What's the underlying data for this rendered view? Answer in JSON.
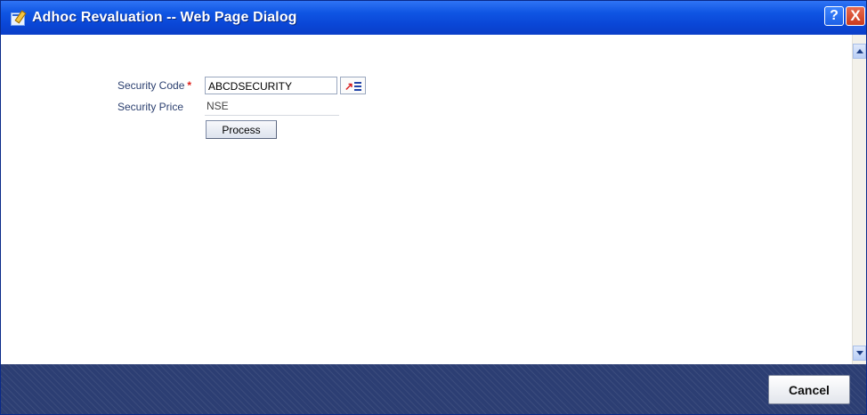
{
  "window": {
    "title": "Adhoc Revaluation -- Web Page Dialog",
    "help_button": "?",
    "close_button": "X"
  },
  "form": {
    "security_code": {
      "label": "Security Code",
      "required_marker": "*",
      "value": "ABCDSECURITY"
    },
    "security_price": {
      "label": "Security Price",
      "value": "NSE"
    },
    "process_button": "Process"
  },
  "footer": {
    "cancel_button": "Cancel"
  },
  "icons": {
    "title": "page-edit-icon",
    "lov": "list-of-values-icon",
    "scroll_up": "scroll-up-arrow-icon",
    "scroll_down": "scroll-down-arrow-icon"
  },
  "colors": {
    "title_bar": "#0b4fe0",
    "footer": "#2c3e73",
    "required": "#e0201a",
    "label": "#2b3f6f"
  }
}
